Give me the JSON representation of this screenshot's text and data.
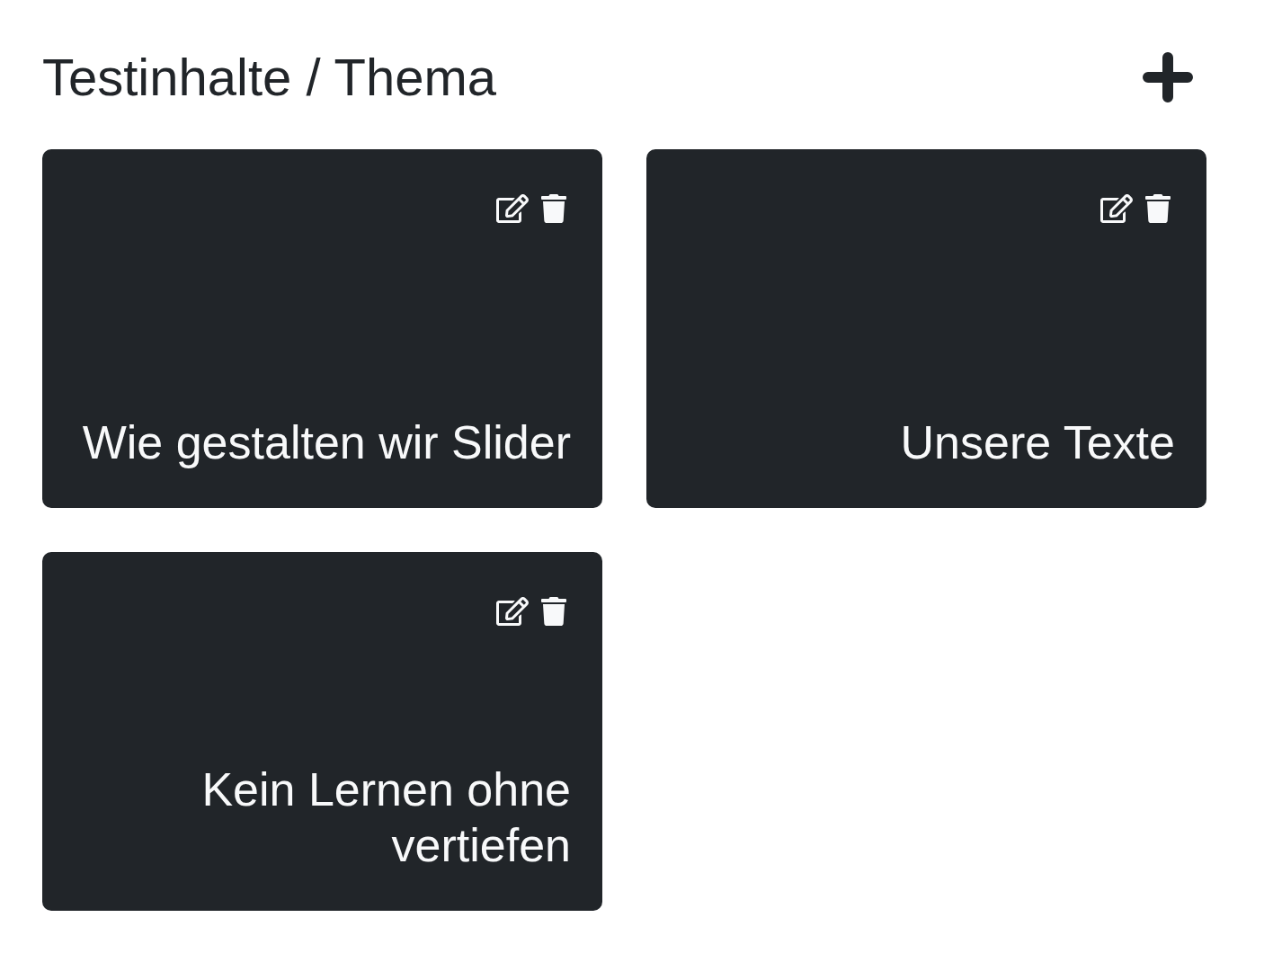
{
  "header": {
    "title": "Testinhalte / Thema"
  },
  "cards": [
    {
      "title": "Wie gestalten wir Slider"
    },
    {
      "title": "Unsere Texte"
    },
    {
      "title": "Kein Lernen ohne vertiefen"
    }
  ]
}
